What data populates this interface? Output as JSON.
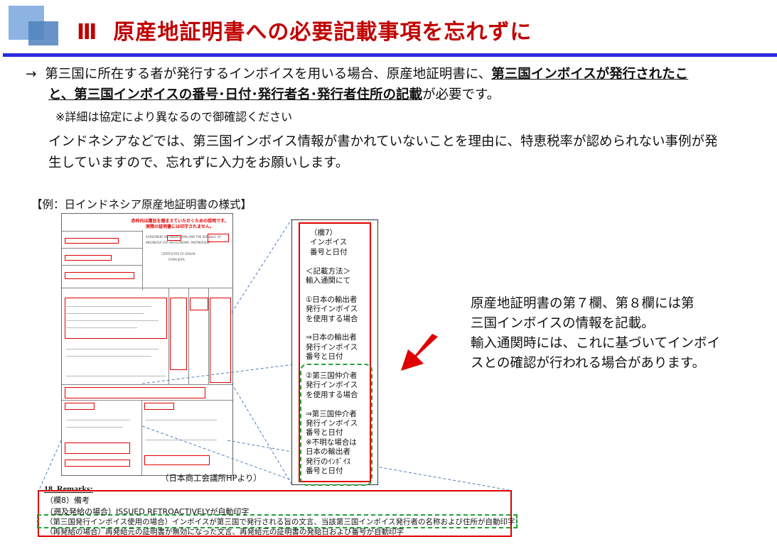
{
  "title": {
    "number": "Ⅲ",
    "text": "原産地証明書への必要記載事項を忘れずに"
  },
  "body": {
    "arrow": "→",
    "p1_a": "第三国に所在する者が発行するインボイスを用いる場合、原産地証明書に、",
    "p1_b": "第三国インボイスが発行されたこ",
    "p1_c": "と、第三国インボイスの番号･日付･発行者名･発行者住所の記載",
    "p1_d": "が必要です。",
    "note": "※詳細は協定により異なるので御確認ください",
    "p2": "インドネシアなどでは、第三国インボイス情報が書かれていないことを理由に、特恵税率が認められない事例が発",
    "p3": "生していますので、忘れずに入力をお願いします。"
  },
  "caption": "【例：日インドネシア原産地証明書の様式】",
  "doc_banner": [
    "赤枠内は趣旨を踏まえていただくための説明です。",
    "実際の証明書には印字されません。"
  ],
  "source": "（日本商工会議所HPより）",
  "zoom_lines": [
    "（欄7）",
    "インボイス",
    "番号と日付",
    "",
    "＜記載方法＞",
    "輸入通関にて",
    "",
    "①日本の輸出者",
    "発行インボイス",
    "を使用する場合",
    "",
    "⇒日本の輸出者",
    "発行インボイス",
    "番号と日付",
    "",
    "②第三国仲介者",
    "発行インボイス",
    "を使用する場合",
    "",
    "⇒第三国仲介者",
    "発行インボイス",
    "番号と日付",
    "※不明な場合は",
    "日本の輸出者",
    "発行のｲﾝﾎﾞｲｽ",
    "番号と日付"
  ],
  "explain": [
    "原産地証明書の第７欄、第８欄には第",
    "三国インボイスの情報を記載。",
    "輸入通関時には、これに基づいてインボイ",
    "スとの確認が行われる場合があります。"
  ],
  "remarks": {
    "heading": "18. Remarks:",
    "lines": [
      "（欄8）備考",
      "（遡及発給の場合）ISSUED RETROACTIVELYが自動印字",
      "（第三国発行インボイス使用の場合）インボイスが第三国で発行される旨の文言、当該第三国インボイス発行者の名称および住所が自動印字",
      "（再発給の場合）再発給元の証明書が無効になった文言、再発給元の証明書の発給日および番号が自動印字"
    ]
  },
  "colors": {
    "title_red": "#c00000",
    "rule_blue": "#2b2bd9",
    "frame_red": "#e00000",
    "frame_green": "#22a03a"
  }
}
